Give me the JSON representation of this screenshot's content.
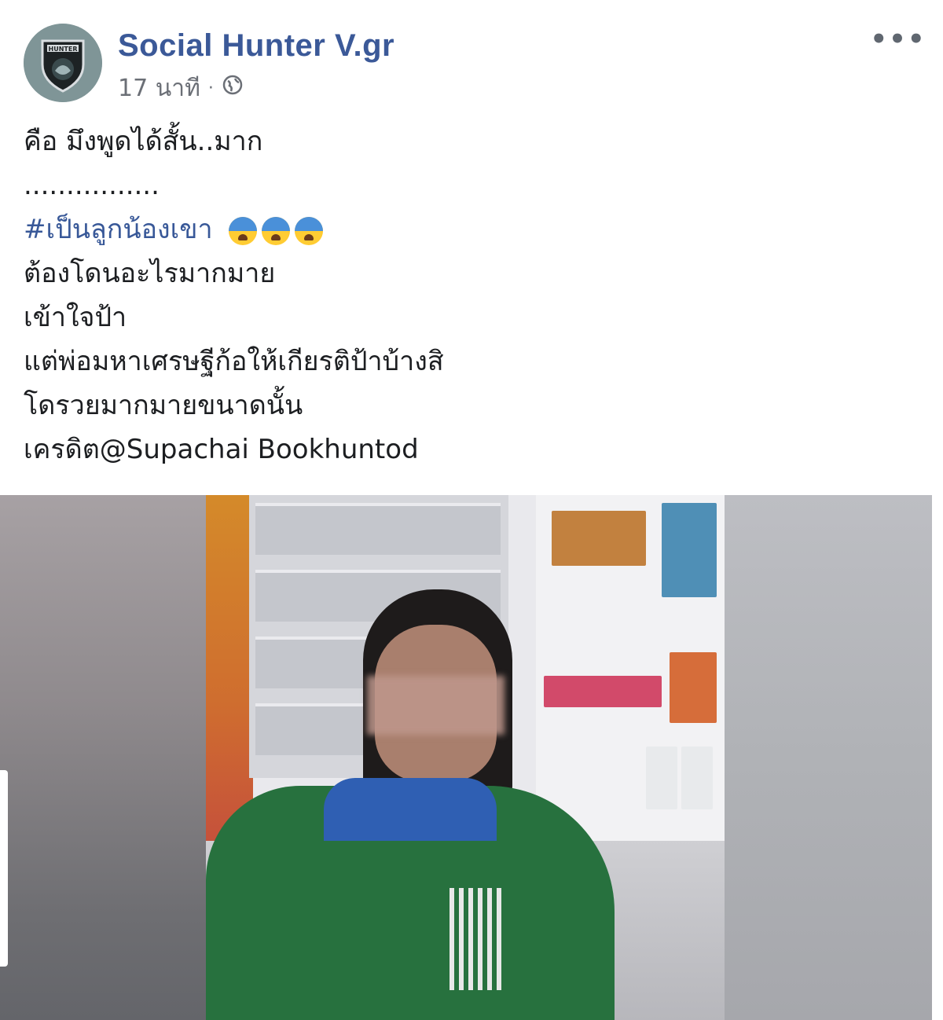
{
  "post": {
    "author": "Social Hunter V.gr",
    "timestamp": "17 นาที",
    "separator": "·",
    "privacy_icon": "globe-icon",
    "more_label": "•••",
    "avatar_text": "HUNTER",
    "lines": [
      "คือ มึงพูดได้สั้น..มาก",
      "................"
    ],
    "hashtag": "#เป็นลูกน้องเขา",
    "emoji": [
      "anxious-face-icon",
      "anxious-face-icon",
      "anxious-face-icon"
    ],
    "lines_after": [
      "ต้องโดนอะไรมากมาย",
      "เข้าใจป้า",
      "แต่พ่อมหาเศรษฐีก้อให้เกียรติป้าบ้างสิ",
      "โดรวยมากมายขนาดนั้น",
      "เครดิต@Supachai Bookhuntod"
    ]
  },
  "colors": {
    "author": "#3b5998",
    "hashtag": "#385898",
    "meta": "#6b6f76",
    "text": "#1c1e21"
  }
}
